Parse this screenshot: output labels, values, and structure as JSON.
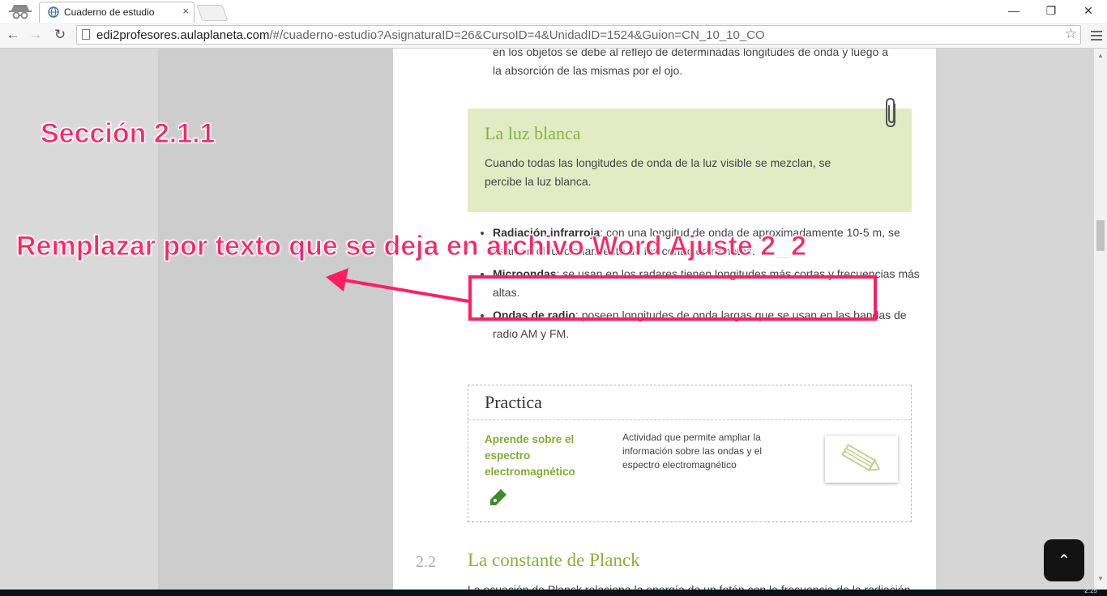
{
  "browser": {
    "tab_title": "Cuaderno de estudio",
    "tab_close": "×",
    "url_host": "edi2profesores.aulaplaneta.com",
    "url_path": "/#/cuaderno-estudio?AsignaturaID=26&CursoID=4&UnidadID=1524&Guion=CN_10_10_CO",
    "window_min": "—",
    "window_max": "❐",
    "window_close": "✕",
    "back": "←",
    "forward": "→",
    "reload": "↻",
    "star": "☆"
  },
  "content": {
    "intro_text": "en los objetos se debe al reflejo de determinadas longitudes de onda y luego a la absorción de las mismas por el ojo.",
    "note": {
      "title": "La luz blanca",
      "text": "Cuando todas las longitudes de onda de la luz visible se mezclan, se percibe la luz blanca."
    },
    "bullets": [
      {
        "term": "Radiación infrarroja",
        "text": ": con una longitud de onda de aproximadamente 10-5 m, se usan en el funcionamiento de los controles remotos."
      },
      {
        "term": "Microondas",
        "text": ": se usan en los radares tienen longitudes más cortas y frecuencias más altas."
      },
      {
        "term": "Ondas de radio",
        "text": ": poseen longitudes de onda largas que se usan en las bandas de radio AM y FM."
      }
    ],
    "practica": {
      "title": "Practica",
      "activity_title": "Aprende sobre el espectro electromagnético",
      "activity_desc": "Actividad que permite ampliar la información sobre las ondas y el espectro electromagnético"
    },
    "section": {
      "number": "2.2",
      "title": "La constante de Planck",
      "text_fragment": "La ecuación de Planck relaciona la energía de un fotón con la frecuencia de la radiación"
    },
    "scroll_top": "⌃"
  },
  "annotations": {
    "section_label": "Sección 2.1.1",
    "replace_note": "Remplazar por texto que se deja en archivo Word Ajuste 2_2",
    "color": "#ff1f60"
  },
  "taskbar": {
    "clock": "2:25"
  }
}
